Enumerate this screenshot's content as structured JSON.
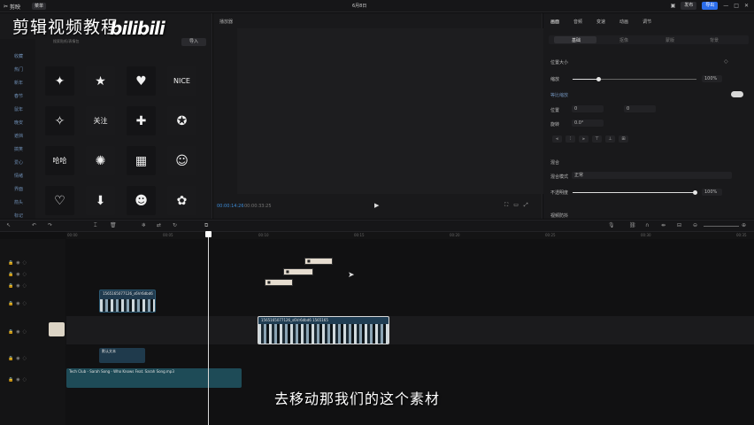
{
  "topbar": {
    "app_name": "剪映",
    "menu": "菜单",
    "project_title": "6月8日",
    "publish": "发布",
    "export": "导出"
  },
  "overlay": {
    "watermark_text": "剪辑视频教程",
    "watermark_logo": "bilibili",
    "subtitle": "去移动那我们的这个素材"
  },
  "media_panel": {
    "search_placeholder": "搜索贴纸/表情包",
    "import_label": "导入",
    "nav_items": [
      "收藏",
      "热门",
      "新年",
      "春节",
      "鼠年",
      "晚安",
      "遮挡",
      "搞笑",
      "爱心",
      "情绪",
      "界面",
      "箭头",
      "标记"
    ],
    "stickers": [
      "✦",
      "★",
      "♥",
      "NICE",
      "✧",
      "关注",
      "✚",
      "✪",
      "哈哈",
      "✺",
      "▦",
      "☺",
      "♡",
      "⬇",
      "☻",
      "✿",
      "✈",
      "✶",
      "▩",
      "☁"
    ]
  },
  "player": {
    "label": "播放器",
    "time_current": "00:00:14:26",
    "time_total": "00:00:33:25"
  },
  "inspector": {
    "tabs": [
      "画面",
      "音频",
      "变速",
      "动画",
      "调节"
    ],
    "subtabs": [
      "基础",
      "抠像",
      "蒙版",
      "背景"
    ],
    "position_size": "位置大小",
    "scale_label": "缩放",
    "scale_value": "100%",
    "uniform_scale": "等比缩放",
    "position_label": "位置",
    "pos_x": "0",
    "pos_y": "0",
    "rotate_label": "旋转",
    "rotate_value": "0.0°",
    "blend_label": "混合",
    "blend_mode_label": "混合模式",
    "blend_mode_value": "正常",
    "opacity_label": "不透明度",
    "opacity_value": "100%",
    "stabilize": "视频防抖"
  },
  "timeline": {
    "ruler": [
      "00:00",
      "00:05",
      "00:10",
      "00:15",
      "00:20",
      "00:25",
      "00:30",
      "00:35"
    ],
    "clip_video1": "1565165077126_s6Vr6dbd6",
    "clip_main": "1565165077126_s6Vr6dbd6 1565165",
    "clip_text1": "默认文本",
    "clip_audio": "Tech Club - Sarah Song - Who Knows Feat. Sarah Song.mp3"
  }
}
